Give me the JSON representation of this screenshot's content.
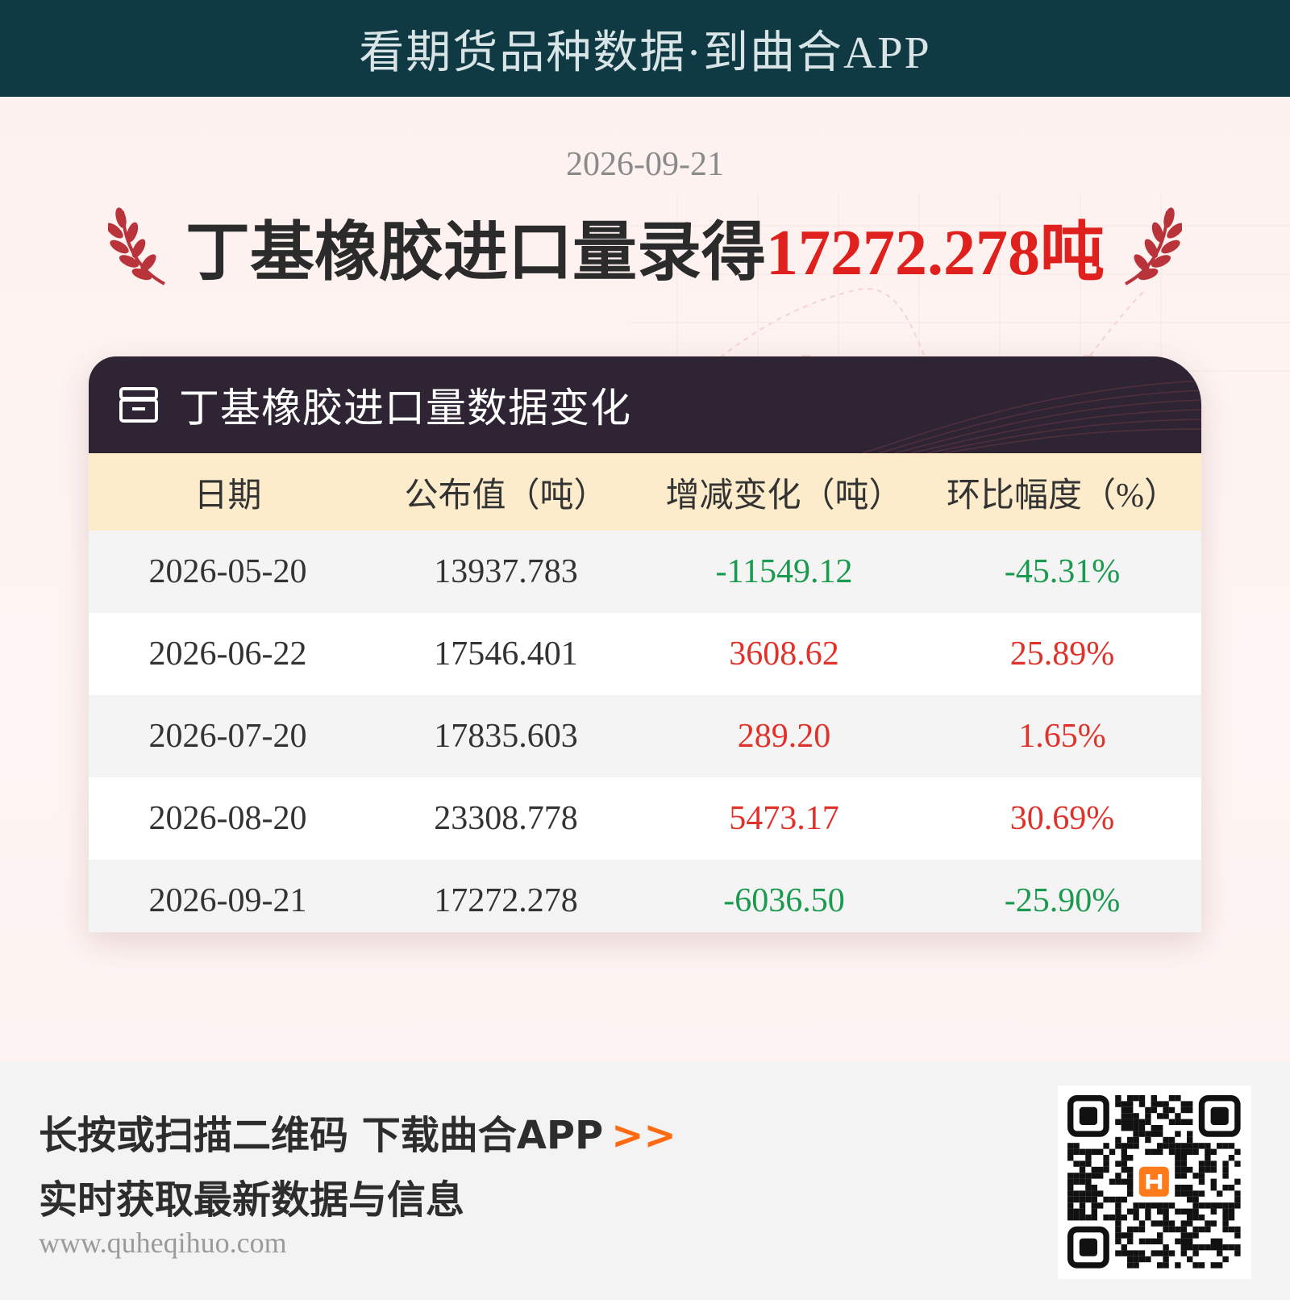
{
  "banner": {
    "text": "看期货品种数据·到曲合APP"
  },
  "report": {
    "date": "2026-09-21",
    "headline_prefix": "丁基橡胶进口量录得",
    "headline_value": "17272.278吨"
  },
  "card": {
    "icon": "archive-box-icon",
    "title": "丁基橡胶进口量数据变化",
    "columns": [
      "日期",
      "公布值（吨）",
      "增减变化（吨）",
      "环比幅度（%）"
    ],
    "rows": [
      {
        "date": "2026-05-20",
        "value": "13937.783",
        "change": "-11549.12",
        "pct": "-45.31%"
      },
      {
        "date": "2026-06-22",
        "value": "17546.401",
        "change": "3608.62",
        "pct": "25.89%"
      },
      {
        "date": "2026-07-20",
        "value": "17835.603",
        "change": "289.20",
        "pct": "1.65%"
      },
      {
        "date": "2026-08-20",
        "value": "23308.778",
        "change": "5473.17",
        "pct": "30.69%"
      },
      {
        "date": "2026-09-21",
        "value": "17272.278",
        "change": "-6036.50",
        "pct": "-25.90%"
      }
    ]
  },
  "footer": {
    "line1": "长按或扫描二维码 下载曲合APP",
    "arrow": ">>",
    "line2": "实时获取最新数据与信息",
    "url": "www.quheqihuo.com"
  },
  "colors": {
    "banner_bg": "#0f3a44",
    "headline_value": "#e0201c",
    "negative": "#1a9a4f",
    "positive": "#e0322a",
    "table_header_bg": "#fdeccb",
    "card_header_bg": "#2f2433",
    "accent_arrow": "#ff6a13"
  }
}
